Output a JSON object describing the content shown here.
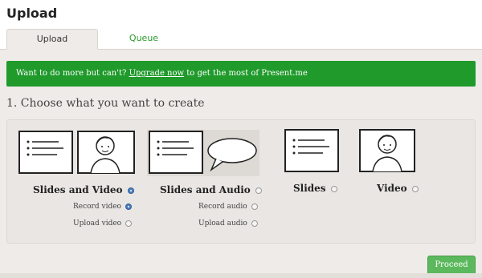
{
  "page": {
    "title": "Upload"
  },
  "tabs": [
    {
      "label": "Upload",
      "active": true
    },
    {
      "label": "Queue",
      "active": false
    }
  ],
  "banner": {
    "prefix": "Want to do more but can't?",
    "link": "Upgrade now",
    "suffix": "to get the most of Present.me"
  },
  "step": {
    "title": "1. Choose what you want to create"
  },
  "options": [
    {
      "label": "Slides and Video",
      "selected": true,
      "illustration": "slides-and-person-icon",
      "sub_options": [
        {
          "label": "Record video",
          "selected": true
        },
        {
          "label": "Upload video",
          "selected": false
        }
      ]
    },
    {
      "label": "Slides and Audio",
      "selected": false,
      "illustration": "slides-and-speech-bubble-icon",
      "sub_options": [
        {
          "label": "Record audio",
          "selected": false
        },
        {
          "label": "Upload audio",
          "selected": false
        }
      ]
    },
    {
      "label": "Slides",
      "selected": false,
      "illustration": "slides-icon",
      "sub_options": []
    },
    {
      "label": "Video",
      "selected": false,
      "illustration": "person-icon",
      "sub_options": []
    }
  ],
  "actions": {
    "proceed": "Proceed"
  },
  "colors": {
    "banner": "#1f9a2b",
    "tab_link": "#2a9a2a",
    "proceed": "#5cb85c",
    "radio_selected": "#4a7fc0"
  }
}
